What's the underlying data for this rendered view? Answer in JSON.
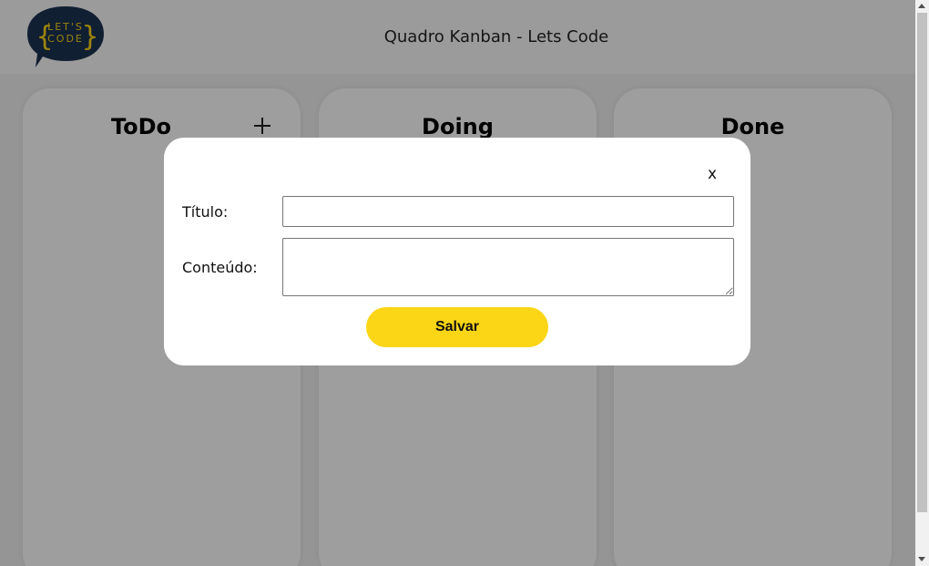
{
  "header": {
    "title": "Quadro Kanban - Lets Code",
    "logo": {
      "line1": "LET'S",
      "line2": "CODE",
      "brace_open": "{",
      "brace_close": "}",
      "bg_color": "#1c3352",
      "text_color": "#fbd617"
    }
  },
  "columns": [
    {
      "title": "ToDo",
      "has_add_button": true
    },
    {
      "title": "Doing"
    },
    {
      "title": "Done"
    }
  ],
  "modal": {
    "close_label": "x",
    "fields": {
      "title_label": "Título:",
      "title_value": "",
      "content_label": "Conteúdo:",
      "content_value": ""
    },
    "save_label": "Salvar"
  },
  "colors": {
    "accent": "#fbd617",
    "overlay": "rgba(0,0,0,0.38)"
  }
}
